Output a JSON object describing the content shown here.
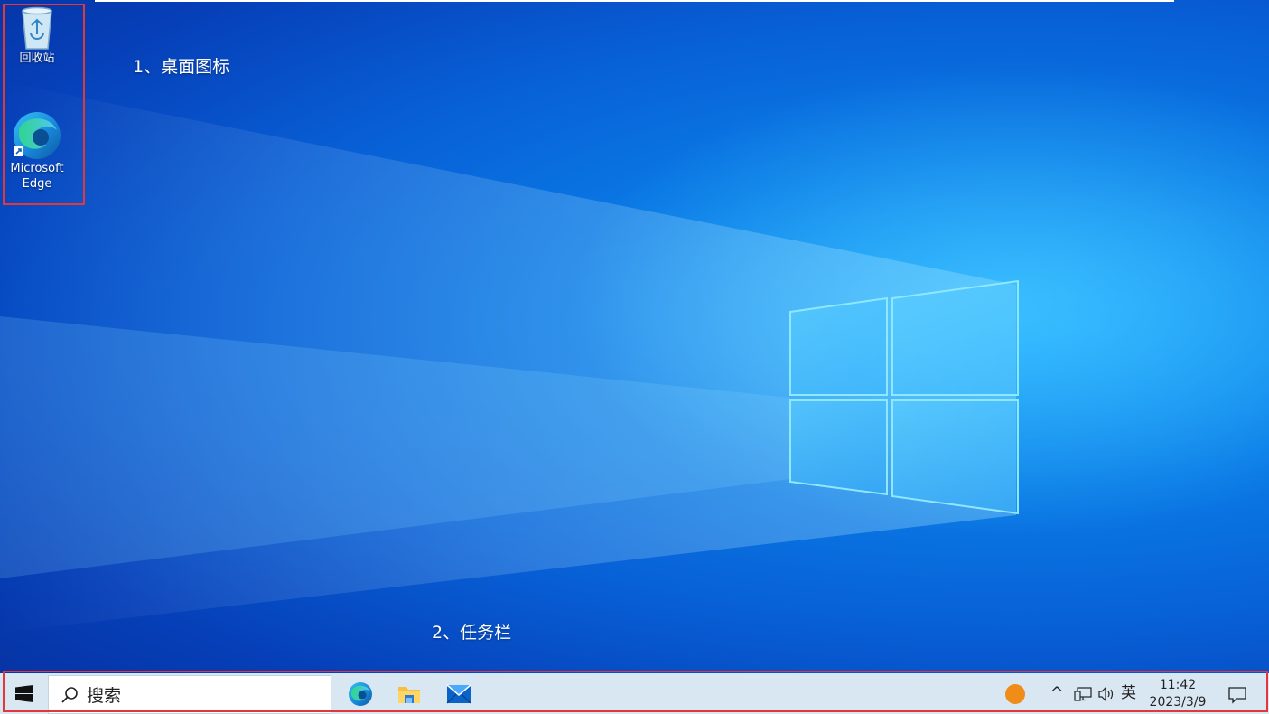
{
  "desktop": {
    "icons": [
      {
        "label": "回收站",
        "icon": "recycle-bin-icon"
      },
      {
        "label": "Microsoft Edge",
        "label_line1": "Microsoft",
        "label_line2": "Edge",
        "icon": "edge-icon"
      }
    ],
    "annotations": {
      "desktop_icons": "1、桌面图标",
      "taskbar": "2、任务栏"
    },
    "wallpaper": "windows-logo-light-beam",
    "accent_color": "#0a7be6",
    "annotation_border_color": "#e2373b"
  },
  "taskbar": {
    "start_icon": "windows-start-icon",
    "search": {
      "placeholder": "搜索",
      "icon": "search-icon"
    },
    "pinned_apps": [
      {
        "name": "Microsoft Edge",
        "icon": "edge-icon"
      },
      {
        "name": "File Explorer",
        "icon": "folder-icon"
      },
      {
        "name": "Mail",
        "icon": "mail-icon"
      }
    ],
    "tray": {
      "weather_icon": "weather-sun-icon",
      "chevron": "^",
      "network_icon": "network-icon",
      "volume_icon": "speaker-icon",
      "ime": "英",
      "time": "11:42",
      "date": "2023/3/9",
      "notification_icon": "notification-icon"
    },
    "background_color": "#d9e7f3"
  }
}
